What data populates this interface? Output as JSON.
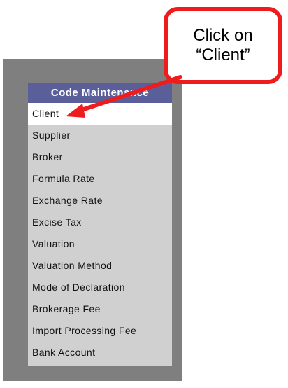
{
  "menu": {
    "header": "Code Maintenance",
    "items": [
      {
        "label": "Client",
        "selected": true
      },
      {
        "label": "Supplier",
        "selected": false
      },
      {
        "label": "Broker",
        "selected": false
      },
      {
        "label": "Formula Rate",
        "selected": false
      },
      {
        "label": "Exchange Rate",
        "selected": false
      },
      {
        "label": "Excise Tax",
        "selected": false
      },
      {
        "label": "Valuation",
        "selected": false
      },
      {
        "label": "Valuation Method",
        "selected": false
      },
      {
        "label": "Mode of Declaration",
        "selected": false
      },
      {
        "label": "Brokerage Fee",
        "selected": false
      },
      {
        "label": "Import Processing Fee",
        "selected": false
      },
      {
        "label": "Bank Account",
        "selected": false
      }
    ]
  },
  "callout": {
    "line1": "Click on",
    "line2": "“Client”"
  },
  "colors": {
    "panel": "#7f7f7f",
    "menu_header": "#5b5f99",
    "menu_bg": "#d0d0d0",
    "selected_bg": "#ffffff",
    "callout_border": "#ee1c1c",
    "arrow": "#ee1c1c"
  }
}
